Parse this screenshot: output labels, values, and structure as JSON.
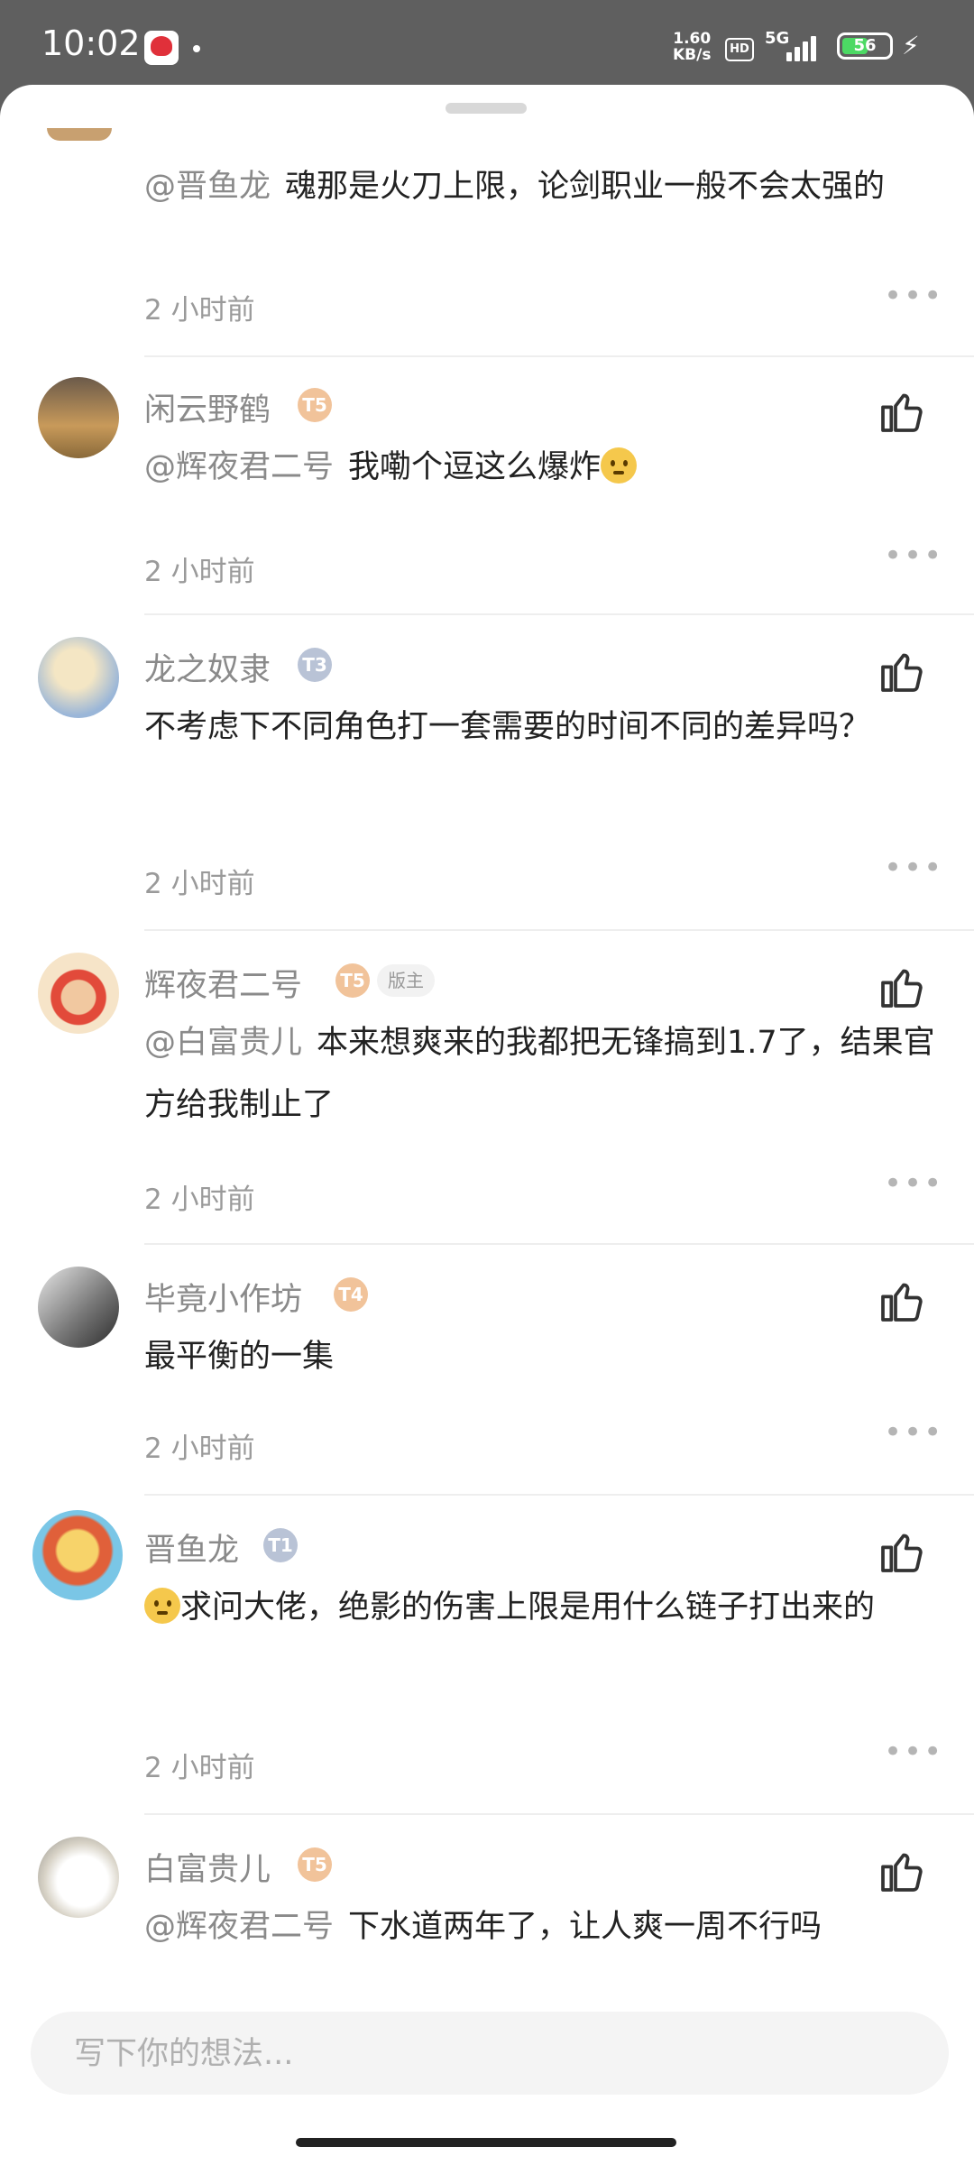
{
  "status_bar": {
    "time": "10:02",
    "net_speed_value": "1.60",
    "net_speed_unit": "KB/s",
    "hd": "HD",
    "network": "5G",
    "battery": "56",
    "battery_level": 0.56
  },
  "comments": [
    {
      "user": "",
      "mention": "@晋鱼龙",
      "text": "魂那是火刀上限，论剑职业一般不会太强的",
      "time": "2 小时前"
    },
    {
      "user": "闲云野鹤",
      "level": "T5",
      "mention": "@辉夜君二号",
      "text": "我嘞个逗这么爆炸",
      "emoji": "face-emoji",
      "time": "2 小时前"
    },
    {
      "user": "龙之奴隶",
      "level": "T3",
      "text": "不考虑下不同角色打一套需要的时间不同的差异吗？",
      "time": "2 小时前"
    },
    {
      "user": "辉夜君二号",
      "level": "T5",
      "role": "版主",
      "mention": "@白富贵儿",
      "text": "本来想爽来的我都把无锋搞到1.7了，结果官方给我制止了",
      "time": "2 小时前"
    },
    {
      "user": "毕竟小作坊",
      "level": "T4",
      "text": "最平衡的一集",
      "time": "2 小时前"
    },
    {
      "user": "晋鱼龙",
      "level": "T1",
      "text": "求问大佬，绝影的伤害上限是用什么链子打出来的",
      "emoji": "face-emoji",
      "time": "2 小时前"
    },
    {
      "user": "白富贵儿",
      "level": "T5",
      "mention": "@辉夜君二号",
      "text": "下水道两年了，让人爽一周不行吗"
    }
  ],
  "input": {
    "placeholder": "写下你的想法..."
  },
  "colors": {
    "username": "#8a8a8a",
    "text": "#222222",
    "level_gold": "#f1c39a",
    "level_silver": "#b9c3d6"
  }
}
